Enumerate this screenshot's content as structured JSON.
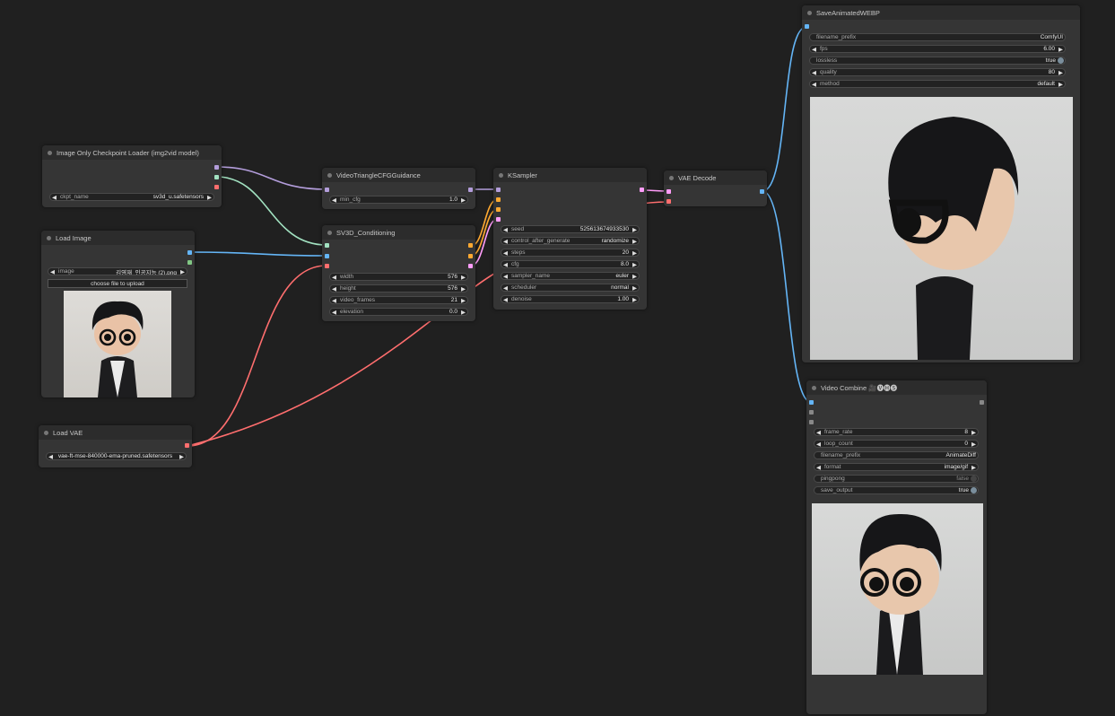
{
  "nodes": {
    "ckpt": {
      "title": "Image Only Checkpoint Loader (img2vid model)",
      "ckpt_name_label": "ckpt_name",
      "ckpt_name_value": "sv3d_u.safetensors"
    },
    "load_image": {
      "title": "Load Image",
      "image_label": "image",
      "image_value": "김영재_인공지능 (2).png",
      "upload_label": "choose file to upload"
    },
    "load_vae": {
      "title": "Load VAE",
      "vae_value": "vae-ft-mse-840000-ema-pruned.safetensors"
    },
    "guidance": {
      "title": "VideoTriangleCFGGuidance",
      "min_cfg_label": "min_cfg",
      "min_cfg_value": "1.0"
    },
    "sv3d": {
      "title": "SV3D_Conditioning",
      "widgets": [
        {
          "label": "width",
          "value": "576"
        },
        {
          "label": "height",
          "value": "576"
        },
        {
          "label": "video_frames",
          "value": "21"
        },
        {
          "label": "elevation",
          "value": "0.0"
        }
      ]
    },
    "ksampler": {
      "title": "KSampler",
      "widgets": [
        {
          "label": "seed",
          "value": "525613674933530"
        },
        {
          "label": "control_after_generate",
          "value": "randomize"
        },
        {
          "label": "steps",
          "value": "20"
        },
        {
          "label": "cfg",
          "value": "8.0"
        },
        {
          "label": "sampler_name",
          "value": "euler"
        },
        {
          "label": "scheduler",
          "value": "normal"
        },
        {
          "label": "denoise",
          "value": "1.00"
        }
      ]
    },
    "vae_decode": {
      "title": "VAE Decode"
    },
    "save_webp": {
      "title": "SaveAnimatedWEBP",
      "widgets": [
        {
          "label": "filename_prefix",
          "value": "ComfyUI"
        },
        {
          "label": "fps",
          "value": "6.00"
        },
        {
          "label": "lossless",
          "value": "true"
        },
        {
          "label": "quality",
          "value": "80"
        },
        {
          "label": "method",
          "value": "default"
        }
      ]
    },
    "video_combine": {
      "title": "Video Combine 🎥🅥🅗🅢",
      "widgets": [
        {
          "label": "frame_rate",
          "value": "8"
        },
        {
          "label": "loop_count",
          "value": "0"
        },
        {
          "label": "filename_prefix",
          "value": "AnimateDiff"
        },
        {
          "label": "format",
          "value": "image/gif"
        },
        {
          "label": "pingpong",
          "value": "false"
        },
        {
          "label": "save_output",
          "value": "true"
        }
      ]
    }
  },
  "colors": {
    "canvas": "#202020",
    "model": "#b39ddb",
    "clip_vision": "#a2e2c1",
    "vae": "#ff6e6e",
    "image": "#64b5f6",
    "conditioning": "#ffa931",
    "latent": "#ff9cf9"
  }
}
